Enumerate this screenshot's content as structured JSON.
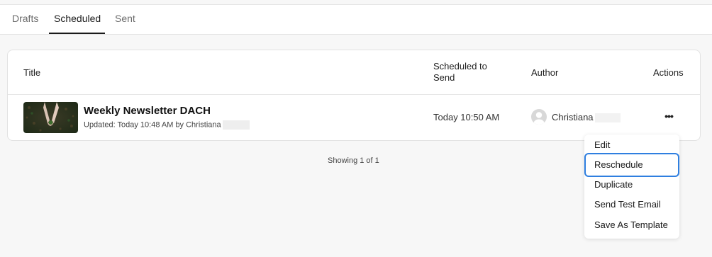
{
  "tabs": [
    {
      "label": "Drafts"
    },
    {
      "label": "Scheduled"
    },
    {
      "label": "Sent"
    }
  ],
  "table": {
    "headers": {
      "title": "Title",
      "scheduled": "Scheduled to Send",
      "author": "Author",
      "actions": "Actions"
    },
    "rows": [
      {
        "title": "Weekly Newsletter DACH",
        "updated": "Updated: Today 10:48 AM by Christiana",
        "scheduled": "Today 10:50 AM",
        "author": "Christiana",
        "actions_icon": "more-horizontal-icon",
        "actions_label": "•••"
      }
    ]
  },
  "pagination": {
    "text": "Showing 1 of 1"
  },
  "actions_menu": {
    "items": [
      "Edit",
      "Reschedule",
      "Duplicate",
      "Send Test Email",
      "Save As Template"
    ],
    "highlighted": "Reschedule"
  },
  "colors": {
    "focus_ring": "#2f7fe0",
    "active_tab": "#1a1a1a"
  }
}
